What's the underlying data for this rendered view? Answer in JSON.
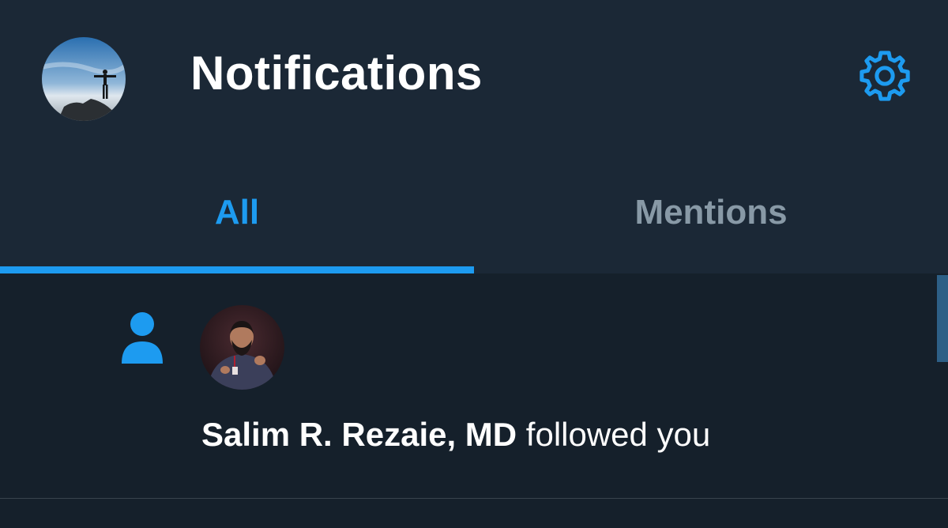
{
  "header": {
    "title": "Notifications",
    "avatar_icon": "user-avatar-icon",
    "settings_icon": "gear-icon"
  },
  "tabs": [
    {
      "label": "All",
      "active": true
    },
    {
      "label": "Mentions",
      "active": false
    }
  ],
  "notifications": [
    {
      "type_icon": "person-icon",
      "user_name": "Salim R. Rezaie, MD",
      "action": " followed you"
    }
  ],
  "colors": {
    "accent": "#1d9bf0",
    "background": "#15202b",
    "header_background": "#1b2836",
    "inactive_tab": "#8899a6"
  }
}
